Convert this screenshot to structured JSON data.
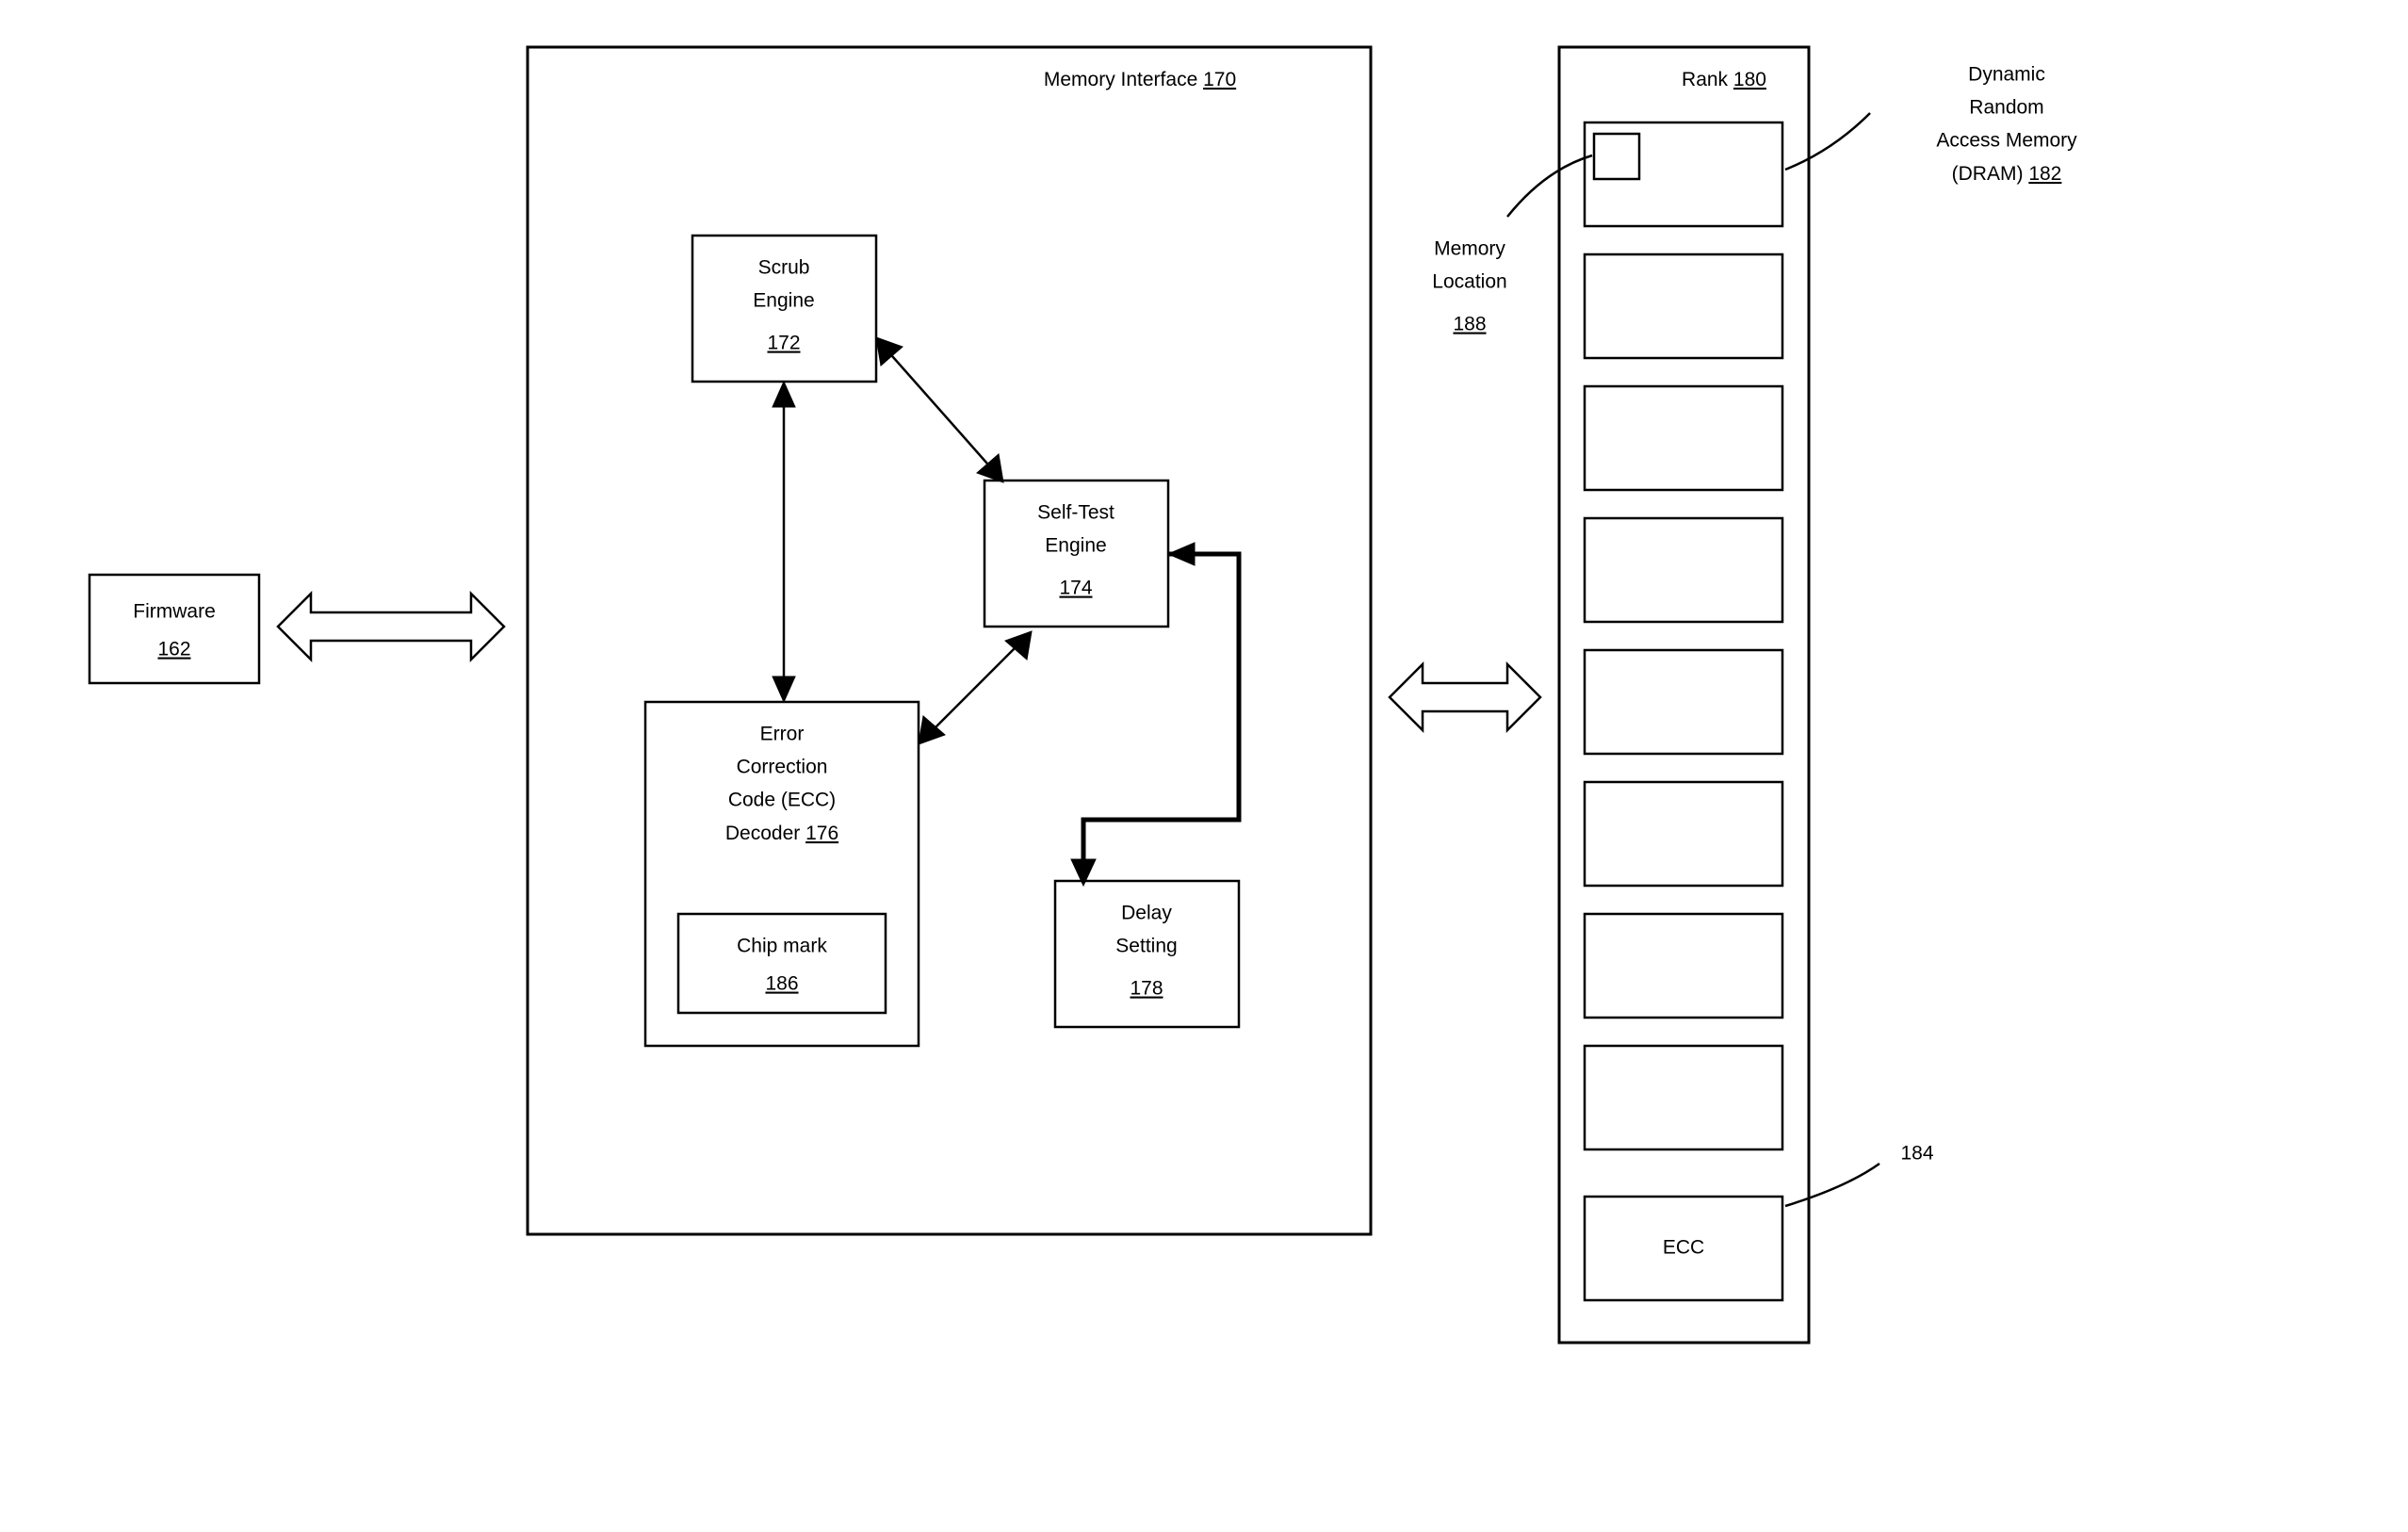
{
  "firmware": {
    "label": "Firmware",
    "num": "162"
  },
  "memory_interface": {
    "label": "Memory Interface",
    "num": "170"
  },
  "scrub_engine": {
    "l1": "Scrub",
    "l2": "Engine",
    "num": "172"
  },
  "self_test": {
    "l1": "Self-Test",
    "l2": "Engine",
    "num": "174"
  },
  "ecc_decoder": {
    "l1": "Error",
    "l2": "Correction",
    "l3": "Code (ECC)",
    "l4": "Decoder",
    "num": "176"
  },
  "chip_mark": {
    "label": "Chip mark",
    "num": "186"
  },
  "delay_setting": {
    "l1": "Delay",
    "l2": "Setting",
    "num": "178"
  },
  "rank": {
    "label": "Rank",
    "num": "180"
  },
  "memory_location": {
    "l1": "Memory",
    "l2": "Location",
    "num": "188"
  },
  "dram": {
    "l1": "Dynamic",
    "l2": "Random",
    "l3": "Access Memory",
    "l4": "(DRAM)",
    "num": "182"
  },
  "ecc_chip": {
    "label": "ECC",
    "num": "184"
  }
}
